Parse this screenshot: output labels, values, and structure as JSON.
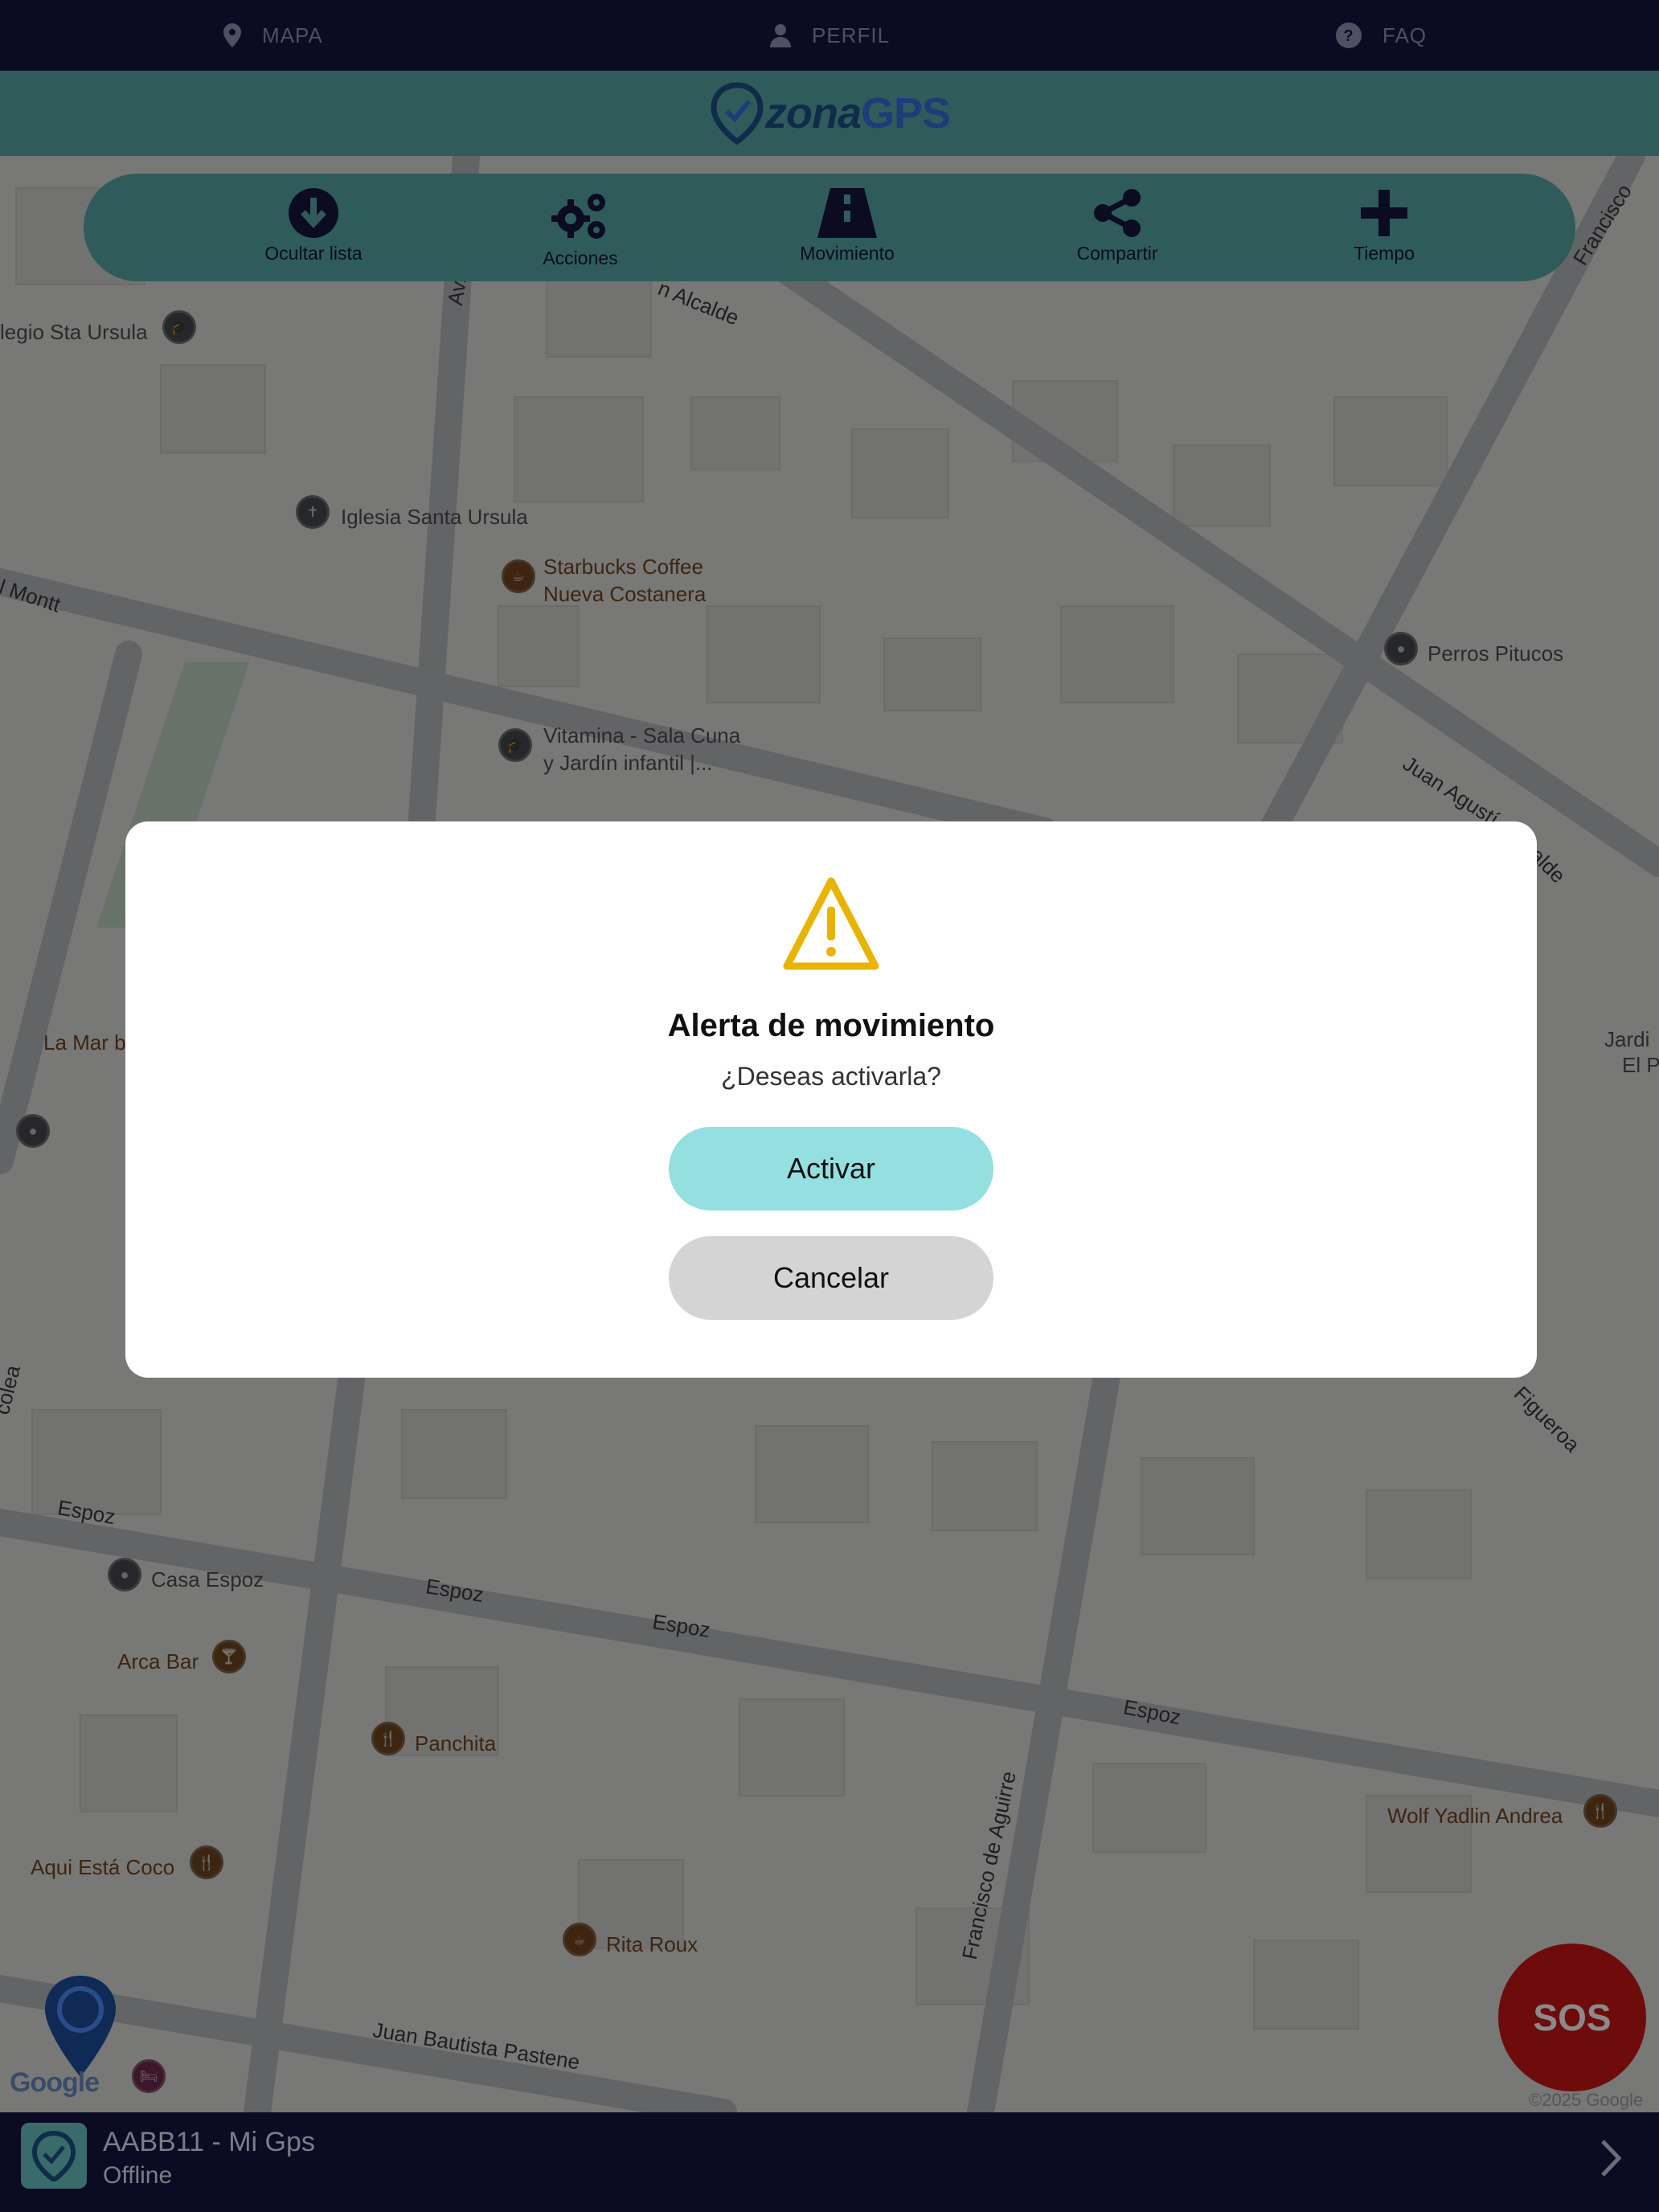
{
  "nav": {
    "items": [
      {
        "label": "MAPA",
        "icon": "map-pin-icon"
      },
      {
        "label": "PERFIL",
        "icon": "user-icon"
      },
      {
        "label": "FAQ",
        "icon": "question-icon"
      }
    ]
  },
  "brand": {
    "name_part1": "zona",
    "name_part2": "GPS"
  },
  "toolbar": {
    "items": [
      {
        "label": "Ocultar lista",
        "icon": "arrow-down-circle-icon"
      },
      {
        "label": "Acciones",
        "icon": "gears-icon"
      },
      {
        "label": "Movimiento",
        "icon": "road-icon"
      },
      {
        "label": "Compartir",
        "icon": "share-icon"
      },
      {
        "label": "Tiempo",
        "icon": "plus-icon"
      }
    ]
  },
  "map": {
    "places": [
      "legio Sta Ursula",
      "Iglesia Santa Ursula",
      "Starbucks Coffee",
      "Nueva Costanera",
      "Perros Pitucos",
      "Vitamina - Sala Cuna",
      "y Jardín infantil |...",
      "La Mar b",
      "Jardi",
      "El P",
      "Casa Espoz",
      "Arca Bar",
      "Panchita",
      "Wolf Yadlin Andrea",
      "Aqui Está Coco",
      "Rita Roux"
    ],
    "streets": [
      "Av.",
      "n Alcalde",
      "Francisco",
      "l Montt",
      "Juan Agustí",
      "alde",
      "Figueroa",
      "colea",
      "Espoz",
      "Espoz",
      "Espoz",
      "Espoz",
      "Francisco de Aguirre",
      "Juan Bautista Pastene"
    ],
    "copyright": "©2025 Google",
    "google_logo": "Google"
  },
  "dialog": {
    "icon": "warning-icon",
    "title": "Alerta de movimiento",
    "subtitle": "¿Deseas activarla?",
    "activate_label": "Activar",
    "cancel_label": "Cancelar"
  },
  "sos": {
    "label": "SOS"
  },
  "device": {
    "name": "AABB11 - Mi Gps",
    "status": "Offline"
  },
  "colors": {
    "accent": "#94dfe0",
    "dialog_bg": "#ffffff",
    "sos": "#6e0b0b",
    "nav_bg": "#0c0b24",
    "warning": "#e8b400"
  }
}
